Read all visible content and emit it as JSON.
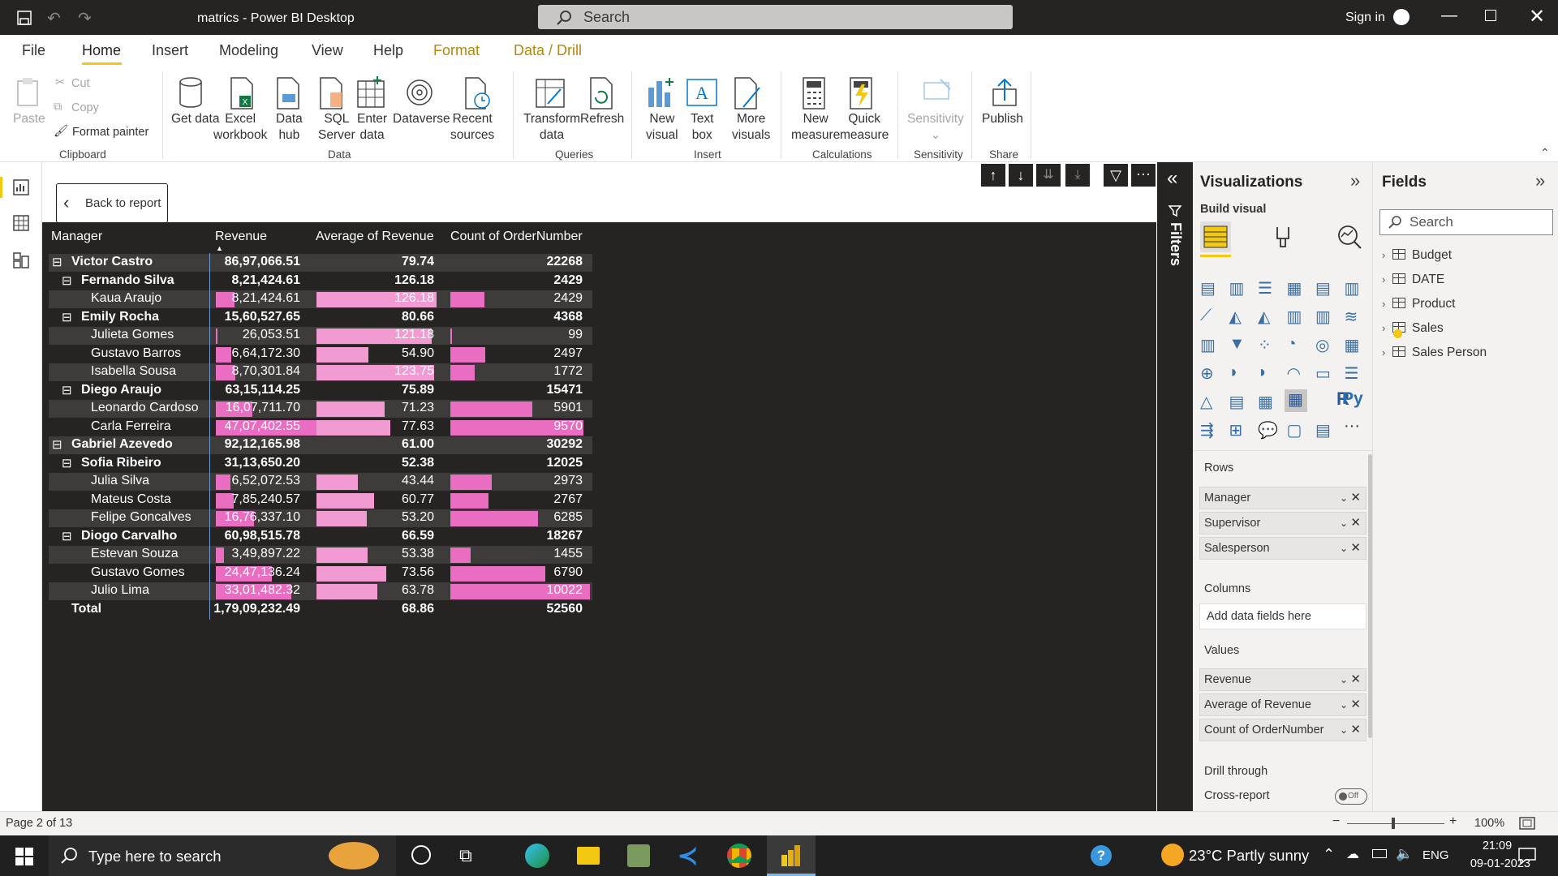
{
  "app": {
    "title": "matrics - Power BI Desktop",
    "search_placeholder": "Search",
    "signin": "Sign in"
  },
  "menu": {
    "file": "File",
    "home": "Home",
    "insert": "Insert",
    "modeling": "Modeling",
    "view": "View",
    "help": "Help",
    "format": "Format",
    "datadrill": "Data / Drill"
  },
  "ribbon": {
    "paste": "Paste",
    "cut": "Cut",
    "copy": "Copy",
    "format_painter": "Format painter",
    "clipboard": "Clipboard",
    "get_data": "Get data",
    "excel_1": "Excel",
    "excel_2": "workbook",
    "datahub_1": "Data",
    "datahub_2": "hub",
    "sql_1": "SQL",
    "sql_2": "Server",
    "enter_1": "Enter",
    "enter_2": "data",
    "dataverse": "Dataverse",
    "recent_1": "Recent",
    "recent_2": "sources",
    "data_group": "Data",
    "transform_1": "Transform",
    "transform_2": "data",
    "refresh": "Refresh",
    "queries": "Queries",
    "newvisual_1": "New",
    "newvisual_2": "visual",
    "textbox_1": "Text",
    "textbox_2": "box",
    "morevis_1": "More",
    "morevis_2": "visuals",
    "insert_group": "Insert",
    "newmeasure_1": "New",
    "newmeasure_2": "measure",
    "quick_1": "Quick",
    "quick_2": "measure",
    "calculations": "Calculations",
    "sensitivity": "Sensitivity",
    "sensitivity_group": "Sensitivity",
    "publish": "Publish",
    "share": "Share"
  },
  "canvas": {
    "back": "Back to report"
  },
  "matrix": {
    "headers": {
      "manager": "Manager",
      "revenue": "Revenue",
      "avg": "Average of Revenue",
      "count": "Count of OrderNumber"
    },
    "rows": [
      {
        "label": "Victor Castro",
        "level": 0,
        "bold": true,
        "exp": "⊟",
        "rev": "86,97,066.51",
        "avg": "79.74",
        "cnt": "22268",
        "rv": 8697066.51,
        "av": 79.74,
        "cv": 22268
      },
      {
        "label": "Fernando Silva",
        "level": 1,
        "bold": true,
        "exp": "⊟",
        "rev": "8,21,424.61",
        "avg": "126.18",
        "cnt": "2429",
        "rv": 821424.61,
        "av": 126.18,
        "cv": 2429
      },
      {
        "label": "Kaua Araujo",
        "level": 2,
        "bold": false,
        "exp": "",
        "rev": "8,21,424.61",
        "avg": "126.18",
        "cnt": "2429",
        "rv": 821424.61,
        "av": 126.18,
        "cv": 2429
      },
      {
        "label": "Emily Rocha",
        "level": 1,
        "bold": true,
        "exp": "⊟",
        "rev": "15,60,527.65",
        "avg": "80.66",
        "cnt": "4368",
        "rv": 1560527.65,
        "av": 80.66,
        "cv": 4368
      },
      {
        "label": "Julieta Gomes",
        "level": 2,
        "bold": false,
        "exp": "",
        "rev": "26,053.51",
        "avg": "121.18",
        "cnt": "99",
        "rv": 26053.51,
        "av": 121.18,
        "cv": 99
      },
      {
        "label": "Gustavo Barros",
        "level": 2,
        "bold": false,
        "exp": "",
        "rev": "6,64,172.30",
        "avg": "54.90",
        "cnt": "2497",
        "rv": 664172.3,
        "av": 54.9,
        "cv": 2497
      },
      {
        "label": "Isabella Sousa",
        "level": 2,
        "bold": false,
        "exp": "",
        "rev": "8,70,301.84",
        "avg": "123.75",
        "cnt": "1772",
        "rv": 870301.84,
        "av": 123.75,
        "cv": 1772
      },
      {
        "label": "Diego Araujo",
        "level": 1,
        "bold": true,
        "exp": "⊟",
        "rev": "63,15,114.25",
        "avg": "75.89",
        "cnt": "15471",
        "rv": 6315114.25,
        "av": 75.89,
        "cv": 15471
      },
      {
        "label": "Leonardo Cardoso",
        "level": 2,
        "bold": false,
        "exp": "",
        "rev": "16,07,711.70",
        "avg": "71.23",
        "cnt": "5901",
        "rv": 1607711.7,
        "av": 71.23,
        "cv": 5901
      },
      {
        "label": "Carla Ferreira",
        "level": 2,
        "bold": false,
        "exp": "",
        "rev": "47,07,402.55",
        "avg": "77.63",
        "cnt": "9570",
        "rv": 4707402.55,
        "av": 77.63,
        "cv": 9570
      },
      {
        "label": "Gabriel Azevedo",
        "level": 0,
        "bold": true,
        "exp": "⊟",
        "rev": "92,12,165.98",
        "avg": "61.00",
        "cnt": "30292",
        "rv": 9212165.98,
        "av": 61.0,
        "cv": 30292
      },
      {
        "label": "Sofia Ribeiro",
        "level": 1,
        "bold": true,
        "exp": "⊟",
        "rev": "31,13,650.20",
        "avg": "52.38",
        "cnt": "12025",
        "rv": 3113650.2,
        "av": 52.38,
        "cv": 12025
      },
      {
        "label": "Julia Silva",
        "level": 2,
        "bold": false,
        "exp": "",
        "rev": "6,52,072.53",
        "avg": "43.44",
        "cnt": "2973",
        "rv": 652072.53,
        "av": 43.44,
        "cv": 2973
      },
      {
        "label": "Mateus Costa",
        "level": 2,
        "bold": false,
        "exp": "",
        "rev": "7,85,240.57",
        "avg": "60.77",
        "cnt": "2767",
        "rv": 785240.57,
        "av": 60.77,
        "cv": 2767
      },
      {
        "label": "Felipe Goncalves",
        "level": 2,
        "bold": false,
        "exp": "",
        "rev": "16,76,337.10",
        "avg": "53.20",
        "cnt": "6285",
        "rv": 1676337.1,
        "av": 53.2,
        "cv": 6285
      },
      {
        "label": "Diogo Carvalho",
        "level": 1,
        "bold": true,
        "exp": "⊟",
        "rev": "60,98,515.78",
        "avg": "66.59",
        "cnt": "18267",
        "rv": 6098515.78,
        "av": 66.59,
        "cv": 18267
      },
      {
        "label": "Estevan Souza",
        "level": 2,
        "bold": false,
        "exp": "",
        "rev": "3,49,897.22",
        "avg": "53.38",
        "cnt": "1455",
        "rv": 349897.22,
        "av": 53.38,
        "cv": 1455
      },
      {
        "label": "Gustavo Gomes",
        "level": 2,
        "bold": false,
        "exp": "",
        "rev": "24,47,136.24",
        "avg": "73.56",
        "cnt": "6790",
        "rv": 2447136.24,
        "av": 73.56,
        "cv": 6790
      },
      {
        "label": "Julio Lima",
        "level": 2,
        "bold": false,
        "exp": "",
        "rev": "33,01,482.32",
        "avg": "63.78",
        "cnt": "10022",
        "rv": 3301482.32,
        "av": 63.78,
        "cv": 10022
      },
      {
        "label": "Total",
        "level": 0,
        "bold": true,
        "exp": "",
        "rev": "1,79,09,232.49",
        "avg": "68.86",
        "cnt": "52560",
        "rv": null,
        "av": null,
        "cv": null
      }
    ]
  },
  "filters": {
    "label": "Filters"
  },
  "viz": {
    "title": "Visualizations",
    "build": "Build visual",
    "rows": "Rows",
    "row_fields": [
      "Manager",
      "Supervisor",
      "Salesperson"
    ],
    "columns": "Columns",
    "columns_placeholder": "Add data fields here",
    "values": "Values",
    "value_fields": [
      "Revenue",
      "Average of Revenue",
      "Count of OrderNumber"
    ],
    "drill": "Drill through",
    "cross": "Cross-report",
    "toggle": "Off",
    "r": "R",
    "py": "Py",
    "more": "···"
  },
  "fields": {
    "title": "Fields",
    "search": "Search",
    "tables": [
      "Budget",
      "DATE",
      "Product",
      "Sales",
      "Sales Person"
    ]
  },
  "status": {
    "page": "Page 2 of 13",
    "zoom": "100%"
  },
  "taskbar": {
    "search": "Type here to search",
    "weather": "23°C  Partly sunny",
    "lang": "ENG",
    "time": "21:09",
    "date": "09-01-2023"
  },
  "colors": {
    "bar": "#e96dc0",
    "bar_light": "#f29bd3",
    "accent": "#f2c811"
  }
}
